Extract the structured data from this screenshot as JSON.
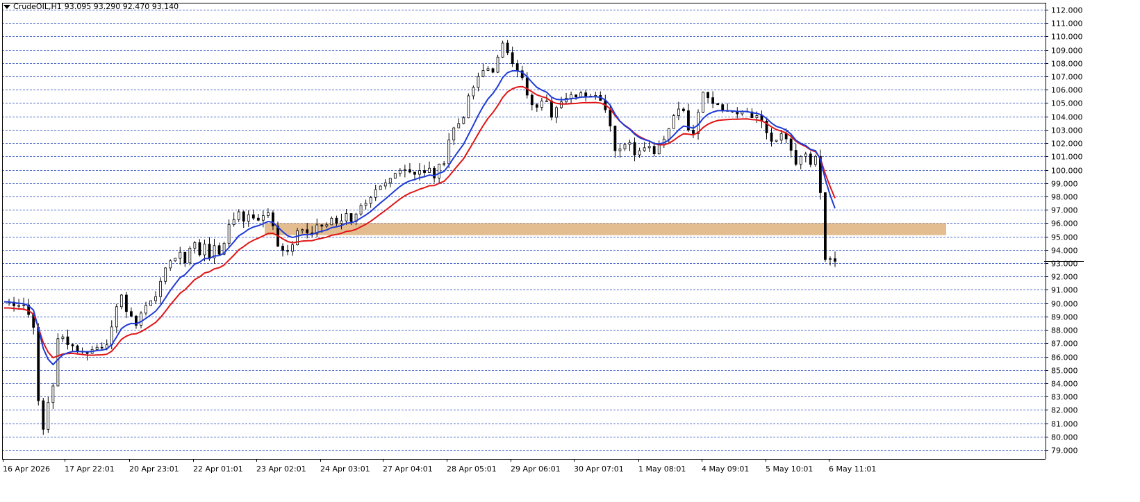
{
  "header": {
    "symbol": "CrudeOIL,H1",
    "ohlc": "93.095 93.290 92.470 93.140"
  },
  "colors": {
    "background": "#ffffff",
    "grid": "#2e4fc0",
    "axis": "#000000",
    "candle": "#000000",
    "ma_fast": "#1f3bd6",
    "ma_slow": "#e01515",
    "zone": "#e2b98a"
  },
  "chart_data": {
    "type": "candlestick",
    "title": "CrudeOIL,H1",
    "y_ticks": [
      "112.000",
      "111.000",
      "110.000",
      "109.000",
      "108.000",
      "107.000",
      "106.000",
      "105.000",
      "104.000",
      "103.000",
      "102.000",
      "101.000",
      "100.000",
      "99.000",
      "98.000",
      "97.000",
      "96.000",
      "95.000",
      "94.000",
      "93.000",
      "92.000",
      "91.000",
      "90.000",
      "89.000",
      "88.000",
      "87.000",
      "86.000",
      "85.000",
      "84.000",
      "83.000",
      "82.000",
      "81.000",
      "80.000",
      "79.000"
    ],
    "y_tick_values": [
      112,
      111,
      110,
      109,
      108,
      107,
      106,
      105,
      104,
      103,
      102,
      101,
      100,
      99,
      98,
      97,
      96,
      95,
      94,
      93,
      92,
      91,
      90,
      89,
      88,
      87,
      86,
      85,
      84,
      83,
      82,
      81,
      80,
      79
    ],
    "x_ticks": [
      "16 Apr 2026",
      "17 Apr 22:01",
      "20 Apr 23:01",
      "22 Apr 01:01",
      "23 Apr 02:01",
      "24 Apr 03:01",
      "27 Apr 04:01",
      "28 Apr 05:01",
      "29 Apr 06:01",
      "30 Apr 07:01",
      "1 May 08:01",
      "4 May 09:01",
      "5 May 10:01",
      "6 May 11:01"
    ],
    "ylim": [
      79,
      112
    ],
    "grid": true,
    "last_price": 93.14,
    "zone": {
      "from": 95.1,
      "to": 96.0
    },
    "price_path": [
      [
        0,
        90.1
      ],
      [
        4,
        89.9
      ],
      [
        6,
        88.4
      ],
      [
        7,
        82.5
      ],
      [
        8,
        80.5
      ],
      [
        9,
        82.6
      ],
      [
        10,
        83.9
      ],
      [
        10.2,
        89.2
      ],
      [
        11,
        87.2
      ],
      [
        12,
        87.4
      ],
      [
        13,
        87.1
      ],
      [
        14,
        86.8
      ],
      [
        15,
        86.5
      ],
      [
        16,
        86.3
      ],
      [
        17,
        86.4
      ],
      [
        18,
        86.5
      ],
      [
        19,
        86.7
      ],
      [
        20,
        86.8
      ],
      [
        21,
        87.1
      ],
      [
        22,
        88.0
      ],
      [
        23,
        89.5
      ],
      [
        24,
        90.8
      ],
      [
        25,
        89.4
      ],
      [
        26,
        88.8
      ],
      [
        27,
        88.5
      ],
      [
        28,
        89.3
      ],
      [
        29,
        89.8
      ],
      [
        30,
        90.1
      ],
      [
        31,
        90.6
      ],
      [
        32,
        91.8
      ],
      [
        33,
        92.4
      ],
      [
        34,
        93.2
      ],
      [
        35,
        93.5
      ],
      [
        36,
        93.8
      ],
      [
        37,
        93.1
      ],
      [
        38,
        94.3
      ],
      [
        38.5,
        95.1
      ],
      [
        39,
        94.4
      ],
      [
        40,
        93.7
      ],
      [
        41,
        94.5
      ],
      [
        42,
        93.6
      ],
      [
        43,
        94.1
      ],
      [
        44,
        93.8
      ],
      [
        45,
        94.3
      ],
      [
        46,
        95.9
      ],
      [
        47,
        96.4
      ],
      [
        48,
        96.8
      ],
      [
        49,
        96.2
      ],
      [
        50,
        96.5
      ],
      [
        51,
        96.3
      ],
      [
        52,
        96.4
      ],
      [
        53,
        96.7
      ],
      [
        54,
        96.8
      ],
      [
        55,
        96.0
      ],
      [
        56,
        94.5
      ],
      [
        57,
        94.0
      ],
      [
        58,
        93.8
      ],
      [
        59,
        94.3
      ],
      [
        60,
        95.2
      ],
      [
        61,
        95.6
      ],
      [
        62,
        95.3
      ],
      [
        63,
        95.2
      ],
      [
        64,
        95.9
      ],
      [
        65,
        95.6
      ],
      [
        66,
        95.9
      ],
      [
        67,
        96.4
      ],
      [
        68,
        96.1
      ],
      [
        69,
        96.3
      ],
      [
        70,
        96.6
      ],
      [
        71,
        96.3
      ],
      [
        72,
        96.8
      ],
      [
        73,
        97.2
      ],
      [
        74,
        97.3
      ],
      [
        75,
        97.7
      ],
      [
        76,
        98.3
      ],
      [
        77,
        98.6
      ],
      [
        78,
        98.9
      ],
      [
        79,
        99.3
      ],
      [
        80,
        99.7
      ],
      [
        81,
        100.2
      ],
      [
        82,
        100.1
      ],
      [
        83,
        99.9
      ],
      [
        84,
        99.8
      ],
      [
        85,
        100.0
      ],
      [
        86,
        99.7
      ],
      [
        87,
        100.0
      ],
      [
        88,
        99.5
      ],
      [
        89,
        100.2
      ],
      [
        90,
        100.7
      ],
      [
        91,
        102.3
      ],
      [
        92,
        103.1
      ],
      [
        93,
        103.5
      ],
      [
        94,
        104.1
      ],
      [
        95,
        105.3
      ],
      [
        96,
        106.2
      ],
      [
        97,
        106.8
      ],
      [
        98,
        107.4
      ],
      [
        99,
        107.6
      ],
      [
        100,
        107.5
      ],
      [
        101,
        108.3
      ],
      [
        102,
        109.3
      ],
      [
        103,
        108.9
      ],
      [
        104,
        108.2
      ],
      [
        105,
        107.6
      ],
      [
        106,
        106.8
      ],
      [
        107,
        105.5
      ],
      [
        108,
        104.8
      ],
      [
        109,
        104.5
      ],
      [
        110,
        105.3
      ],
      [
        111,
        105.0
      ],
      [
        112,
        104.1
      ],
      [
        113,
        104.9
      ],
      [
        114,
        105.3
      ],
      [
        115,
        105.6
      ],
      [
        116,
        105.6
      ],
      [
        117,
        105.3
      ],
      [
        118,
        105.6
      ],
      [
        119,
        105.7
      ],
      [
        120,
        105.5
      ],
      [
        121,
        105.8
      ],
      [
        122,
        105.3
      ],
      [
        123,
        104.5
      ],
      [
        124,
        103.5
      ],
      [
        125,
        101.5
      ],
      [
        126,
        101.7
      ],
      [
        127,
        102.0
      ],
      [
        128,
        101.9
      ],
      [
        129,
        101.3
      ],
      [
        130,
        101.6
      ],
      [
        131,
        101.9
      ],
      [
        132,
        101.7
      ],
      [
        133,
        101.4
      ],
      [
        134,
        101.9
      ],
      [
        135,
        102.5
      ],
      [
        136,
        103.1
      ],
      [
        137,
        104.1
      ],
      [
        138,
        104.8
      ],
      [
        139,
        104.3
      ],
      [
        140,
        103.0
      ],
      [
        141,
        102.6
      ],
      [
        142,
        104.4
      ],
      [
        143,
        105.6
      ],
      [
        144,
        105.3
      ],
      [
        145,
        104.9
      ],
      [
        146,
        105.0
      ],
      [
        147,
        104.5
      ],
      [
        148,
        104.6
      ],
      [
        149,
        104.2
      ],
      [
        150,
        104.4
      ],
      [
        151,
        104.6
      ],
      [
        152,
        104.5
      ],
      [
        153,
        104.0
      ],
      [
        154,
        104.3
      ],
      [
        155,
        103.6
      ],
      [
        156,
        102.8
      ],
      [
        157,
        102.2
      ],
      [
        158,
        102.2
      ],
      [
        159,
        102.5
      ],
      [
        160,
        102.3
      ],
      [
        161,
        101.5
      ],
      [
        162,
        100.6
      ],
      [
        163,
        100.8
      ],
      [
        164,
        101.1
      ],
      [
        165,
        100.4
      ],
      [
        166,
        100.8
      ],
      [
        167,
        98.2
      ],
      [
        168,
        93.3
      ],
      [
        169,
        93.1
      ]
    ]
  }
}
